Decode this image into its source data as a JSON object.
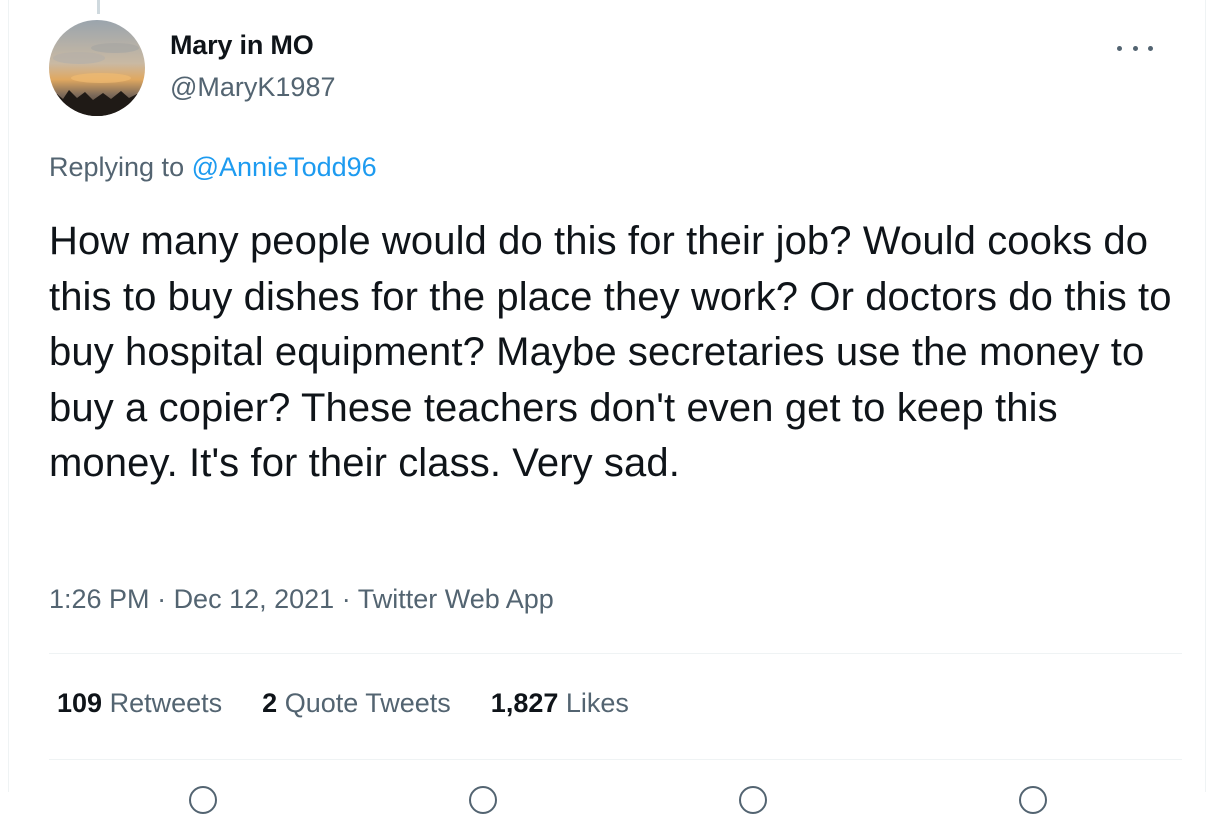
{
  "tweet": {
    "author": {
      "display_name": "Mary in MO",
      "handle": "@MaryK1987"
    },
    "replying_prefix": "Replying to",
    "replying_to": "@AnnieTodd96",
    "text": "How many people would do this for their job? Would cooks do this to buy dishes for the place they work? Or doctors do this to buy hospital equipment? Maybe secretaries use the money to buy a copier? These teachers don't even get to keep this money. It's for their class. Very sad.",
    "time": "1:26 PM",
    "date": "Dec 12, 2021",
    "source": "Twitter Web App",
    "separator": " · "
  },
  "stats": {
    "retweets_count": "109",
    "retweets_label": "Retweets",
    "quotes_count": "2",
    "quotes_label": "Quote Tweets",
    "likes_count": "1,827",
    "likes_label": "Likes"
  },
  "icons": {
    "more": "more-horizontal-icon",
    "reply": "reply-icon",
    "retweet": "retweet-icon",
    "like": "heart-icon",
    "share": "share-icon"
  },
  "colors": {
    "link": "#1d9bf0",
    "secondary_text": "#536471",
    "primary_text": "#0f1419",
    "divider": "#eff3f4"
  }
}
